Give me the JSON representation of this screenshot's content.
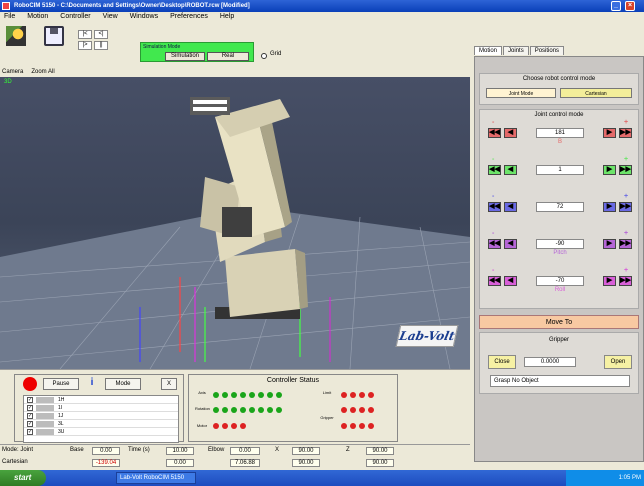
{
  "window": {
    "title": "RoboCIM 5150 - C:\\Documents and Settings\\Owner\\Desktop\\ROBOT.rcw [Modified]"
  },
  "menu": [
    "File",
    "Motion",
    "Controller",
    "View",
    "Windows",
    "Preferences",
    "Help"
  ],
  "toolbar": {
    "mode_title": "Simulation Mode",
    "sim_button": "Simulation",
    "real_button": "Real",
    "grid_label": "Grid",
    "step_labels": [
      "|<",
      "<|",
      "|>",
      "||"
    ]
  },
  "view_tabs": [
    "Camera",
    "Zoom All"
  ],
  "scene": {
    "corner_label": "3D",
    "logo": "Lab-Volt"
  },
  "right_panel": {
    "tabs": [
      "Motion",
      "Joints",
      "Positions"
    ],
    "control_title": "Choose robot control mode",
    "control_buttons": [
      "Joint Mode",
      "Cartesian"
    ],
    "joints_title": "Joint control mode",
    "axes": [
      {
        "value": "181",
        "label": "B",
        "color": "#e46a6a"
      },
      {
        "value": "1",
        "label": "",
        "color": "#6de46a"
      },
      {
        "value": "72",
        "label": "",
        "color": "#6a6ae4"
      },
      {
        "value": "-90",
        "label": "Pitch",
        "color": "#b566d6"
      },
      {
        "value": "-70",
        "label": "Roll",
        "color": "#d85fd8"
      }
    ],
    "move_to": "Move To",
    "gripper": {
      "title": "Gripper",
      "close": "Close",
      "value": "0.0000",
      "open": "Open",
      "object": "Grasp No Object"
    }
  },
  "bottom": {
    "pause": "Pause",
    "info": "i",
    "mode": "Mode",
    "close": "X",
    "list": [
      "1H",
      "1I",
      "1J",
      "3L",
      "3U"
    ],
    "controller_title": "Controller Status",
    "status_rows": [
      "Axis",
      "Rotation",
      "Motor",
      "Limit",
      "Gripper"
    ]
  },
  "statusbar": {
    "mode_label": "Mode: Joint",
    "coords_label": "Cartesian",
    "pos_label": "Base",
    "pos_value": "0.00",
    "time_label": "Time (s)",
    "time_value": "10.00",
    "field1": "-139.04",
    "field2": "0.00",
    "f3_label": "Elbow",
    "f3": "0.00",
    "f4": "7.06.88",
    "f5_label": "X",
    "f5": "90.00",
    "f6": "90.00",
    "f7_label": "Z",
    "f7": "90.00",
    "f8": "90.00"
  },
  "taskbar": {
    "start": "start",
    "item": "Lab-Volt RoboCIM 5150",
    "clock": "1:05 PM"
  }
}
